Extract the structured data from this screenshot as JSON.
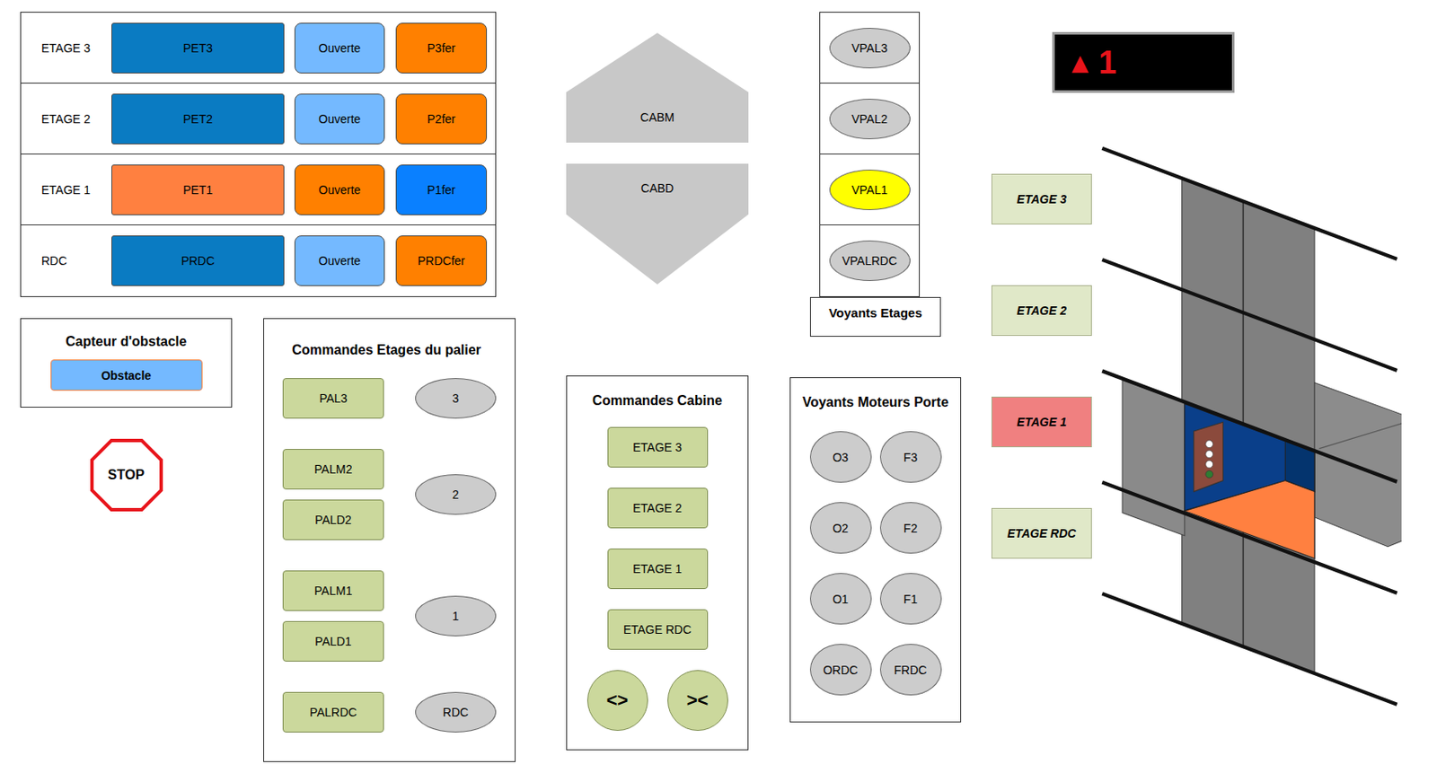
{
  "floor_table": {
    "rows": [
      {
        "label": "ETAGE 3",
        "position": {
          "text": "PET3",
          "active": false
        },
        "open": {
          "text": "Ouverte",
          "active": false
        },
        "closed": {
          "text": "P3fer",
          "active": true
        }
      },
      {
        "label": "ETAGE 2",
        "position": {
          "text": "PET2",
          "active": false
        },
        "open": {
          "text": "Ouverte",
          "active": false
        },
        "closed": {
          "text": "P2fer",
          "active": true
        }
      },
      {
        "label": "ETAGE 1",
        "position": {
          "text": "PET1",
          "active": true
        },
        "open": {
          "text": "Ouverte",
          "active": true
        },
        "closed": {
          "text": "P1fer",
          "active": false
        }
      },
      {
        "label": "RDC",
        "position": {
          "text": "PRDC",
          "active": false
        },
        "open": {
          "text": "Ouverte",
          "active": false
        },
        "closed": {
          "text": "PRDCfer",
          "active": true
        }
      }
    ]
  },
  "obstacle_sensor": {
    "title": "Capteur d'obstacle",
    "button": "Obstacle",
    "active": false
  },
  "stop_button": "STOP",
  "landing_commands": {
    "title": "Commandes Etages du palier",
    "groups": [
      {
        "buttons": [
          "PAL3"
        ],
        "indicator": {
          "text": "3",
          "lit": false
        }
      },
      {
        "buttons": [
          "PALM2",
          "PALD2"
        ],
        "indicator": {
          "text": "2",
          "lit": false
        }
      },
      {
        "buttons": [
          "PALM1",
          "PALD1"
        ],
        "indicator": {
          "text": "1",
          "lit": false
        }
      },
      {
        "buttons": [
          "PALRDC"
        ],
        "indicator": {
          "text": "RDC",
          "lit": false
        }
      }
    ]
  },
  "cabin_sensors": [
    {
      "label": "CABM",
      "direction": "up",
      "active": false
    },
    {
      "label": "CABD",
      "direction": "down",
      "active": false
    }
  ],
  "floor_lights": {
    "title": "Voyants Etages",
    "items": [
      {
        "label": "VPAL3",
        "lit": false
      },
      {
        "label": "VPAL2",
        "lit": false
      },
      {
        "label": "VPAL1",
        "lit": true
      },
      {
        "label": "VPALRDC",
        "lit": false
      }
    ]
  },
  "display": {
    "arrow": "▲",
    "floor": "1"
  },
  "cabin_commands": {
    "title": "Commandes Cabine",
    "buttons": [
      "ETAGE 3",
      "ETAGE 2",
      "ETAGE 1",
      "ETAGE RDC"
    ],
    "door_buttons": [
      "<>",
      "><"
    ]
  },
  "door_motor_lights": {
    "title": "Voyants Moteurs Porte",
    "items": [
      {
        "label": "O3",
        "lit": false
      },
      {
        "label": "F3",
        "lit": false
      },
      {
        "label": "O2",
        "lit": false
      },
      {
        "label": "F2",
        "lit": false
      },
      {
        "label": "O1",
        "lit": false
      },
      {
        "label": "F1",
        "lit": false
      },
      {
        "label": "ORDC",
        "lit": false
      },
      {
        "label": "FRDC",
        "lit": false
      }
    ]
  },
  "floor_labels": [
    {
      "label": "ETAGE 3",
      "current": false
    },
    {
      "label": "ETAGE 2",
      "current": false
    },
    {
      "label": "ETAGE 1",
      "current": true
    },
    {
      "label": "ETAGE RDC",
      "current": false
    }
  ],
  "shaft": {
    "cabin_floor": 1
  }
}
